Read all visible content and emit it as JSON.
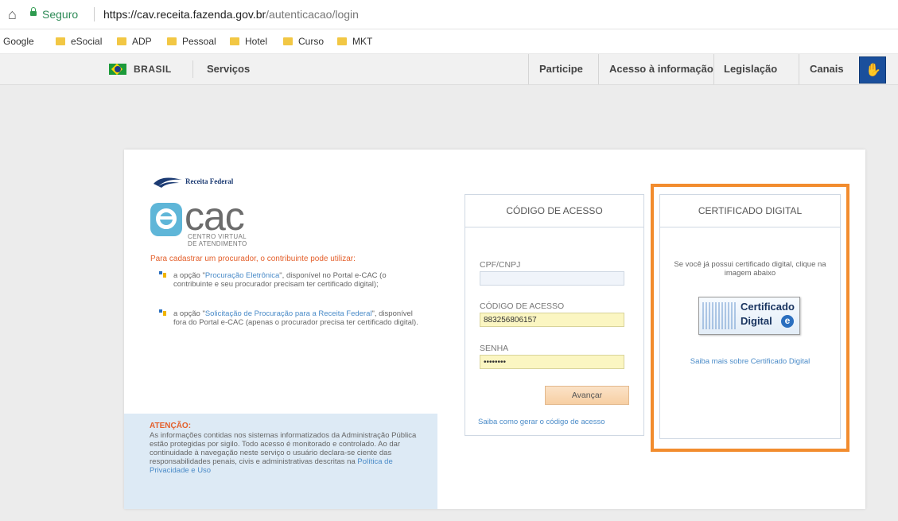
{
  "browser": {
    "secure_label": "Seguro",
    "url_base": "https://cav.receita.fazenda.gov.br",
    "url_path": "/autenticacao/login"
  },
  "bookmarks": [
    "Google",
    "eSocial",
    "ADP",
    "Pessoal",
    "Hotel",
    "Curso",
    "MKT"
  ],
  "gov_bar": {
    "country": "BRASIL",
    "services": "Serviços",
    "links": [
      "Participe",
      "Acesso à informação",
      "Legislação",
      "Canais"
    ]
  },
  "brand": {
    "receita": "Receita Federal",
    "ecac": "cac",
    "ecac_sub_1": "CENTRO VIRTUAL",
    "ecac_sub_2": "DE ATENDIMENTO"
  },
  "procurador": {
    "intro": "Para cadastrar um procurador, o contribuinte pode utilizar:",
    "option1_prefix": "a opção \"",
    "option1_link": "Procuração Eletrônica",
    "option1_suffix": "\", disponível no Portal e-CAC (o contribuinte e seu procurador precisam ter certificado digital);",
    "option2_prefix": "a opção \"",
    "option2_link": "Solicitação de Procuração para a Receita Federal",
    "option2_suffix": "\", disponível fora do Portal e-CAC (apenas o procurador precisa ter certificado digital)."
  },
  "attention": {
    "title": "ATENÇÃO:",
    "body": "As informações contidas nos sistemas informatizados da Administração Pública estão protegidas por sigilo. Todo acesso é monitorado e controlado. Ao dar continuidade à navegação neste serviço o usuário declara-se ciente das responsabilidades penais, civis e administrativas descritas na ",
    "link": "Política de Privacidade e Uso"
  },
  "access_code": {
    "header": "CÓDIGO DE ACESSO",
    "cpf_label": "CPF/CNPJ",
    "cpf_value": "",
    "code_label": "CÓDIGO DE ACESSO",
    "code_value": "883256806157",
    "password_label": "SENHA",
    "password_value": "••••••••",
    "advance_button": "Avançar",
    "how_generate": "Saiba como gerar o código de acesso"
  },
  "certificate": {
    "header": "CERTIFICADO DIGITAL",
    "info": "Se você já possui certificado digital, clique na imagem abaixo",
    "image_line1": "Certificado",
    "image_line2": "Digital",
    "learn_more": "Saiba mais sobre Certificado Digital"
  },
  "colors": {
    "highlight": "#f28c2e",
    "link": "#4a8bc8",
    "warning_text": "#e4602c",
    "attention_bg": "#ddeaf5"
  }
}
